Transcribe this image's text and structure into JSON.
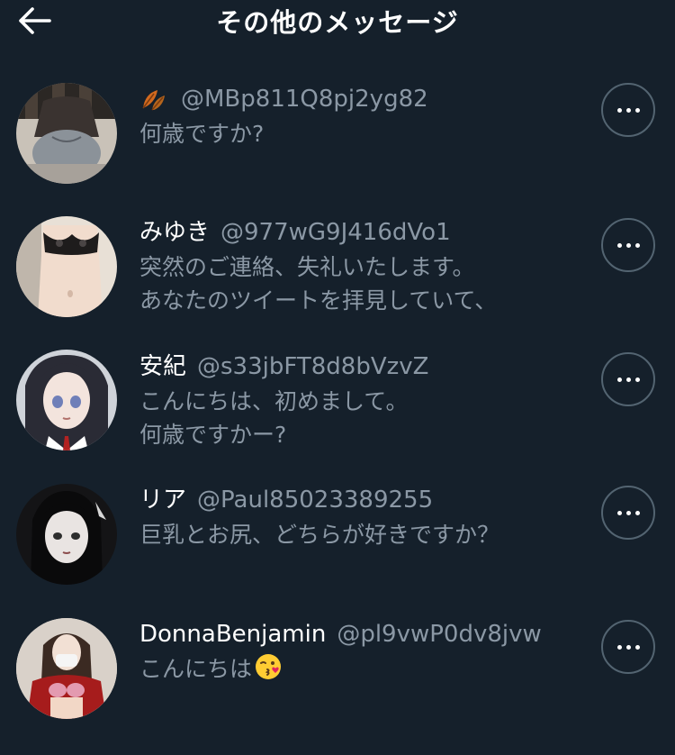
{
  "header": {
    "title": "その他のメッセージ",
    "back_icon": "arrow-left-icon"
  },
  "messages": [
    {
      "display_name": "",
      "name_icon": "fallen-leaf-icon",
      "handle": "@MBp811Q8pj2yg82",
      "lines": [
        "何歳ですか?"
      ],
      "avatar": "photo-back-view"
    },
    {
      "display_name": "みゆき",
      "handle": "@977wG9J416dVo1",
      "lines": [
        "突然のご連絡、失礼いたします。",
        "あなたのツイートを拝見していて、"
      ],
      "avatar": "photo-torso"
    },
    {
      "display_name": "安紀",
      "handle": "@s33jbFT8d8bVzvZ",
      "lines": [
        "こんにちは、初めまして。",
        "何歳ですかー?"
      ],
      "avatar": "anime-girl-dark-hair"
    },
    {
      "display_name": "リア",
      "handle": "@Paul85023389255",
      "lines": [
        "巨乳とお尻、どちらが好きですか？"
      ],
      "avatar": "illustration-girl-black-hair"
    },
    {
      "display_name": "DonnaBenjamin",
      "handle": "@pl9vwP0dv8jvw",
      "lines": [
        "こんにちは"
      ],
      "message_emoji": "face-blowing-kiss-icon",
      "avatar": "photo-red-outfit"
    }
  ],
  "colors": {
    "background": "#15202b",
    "secondary_text": "#8b98a5",
    "border": "#536471"
  }
}
